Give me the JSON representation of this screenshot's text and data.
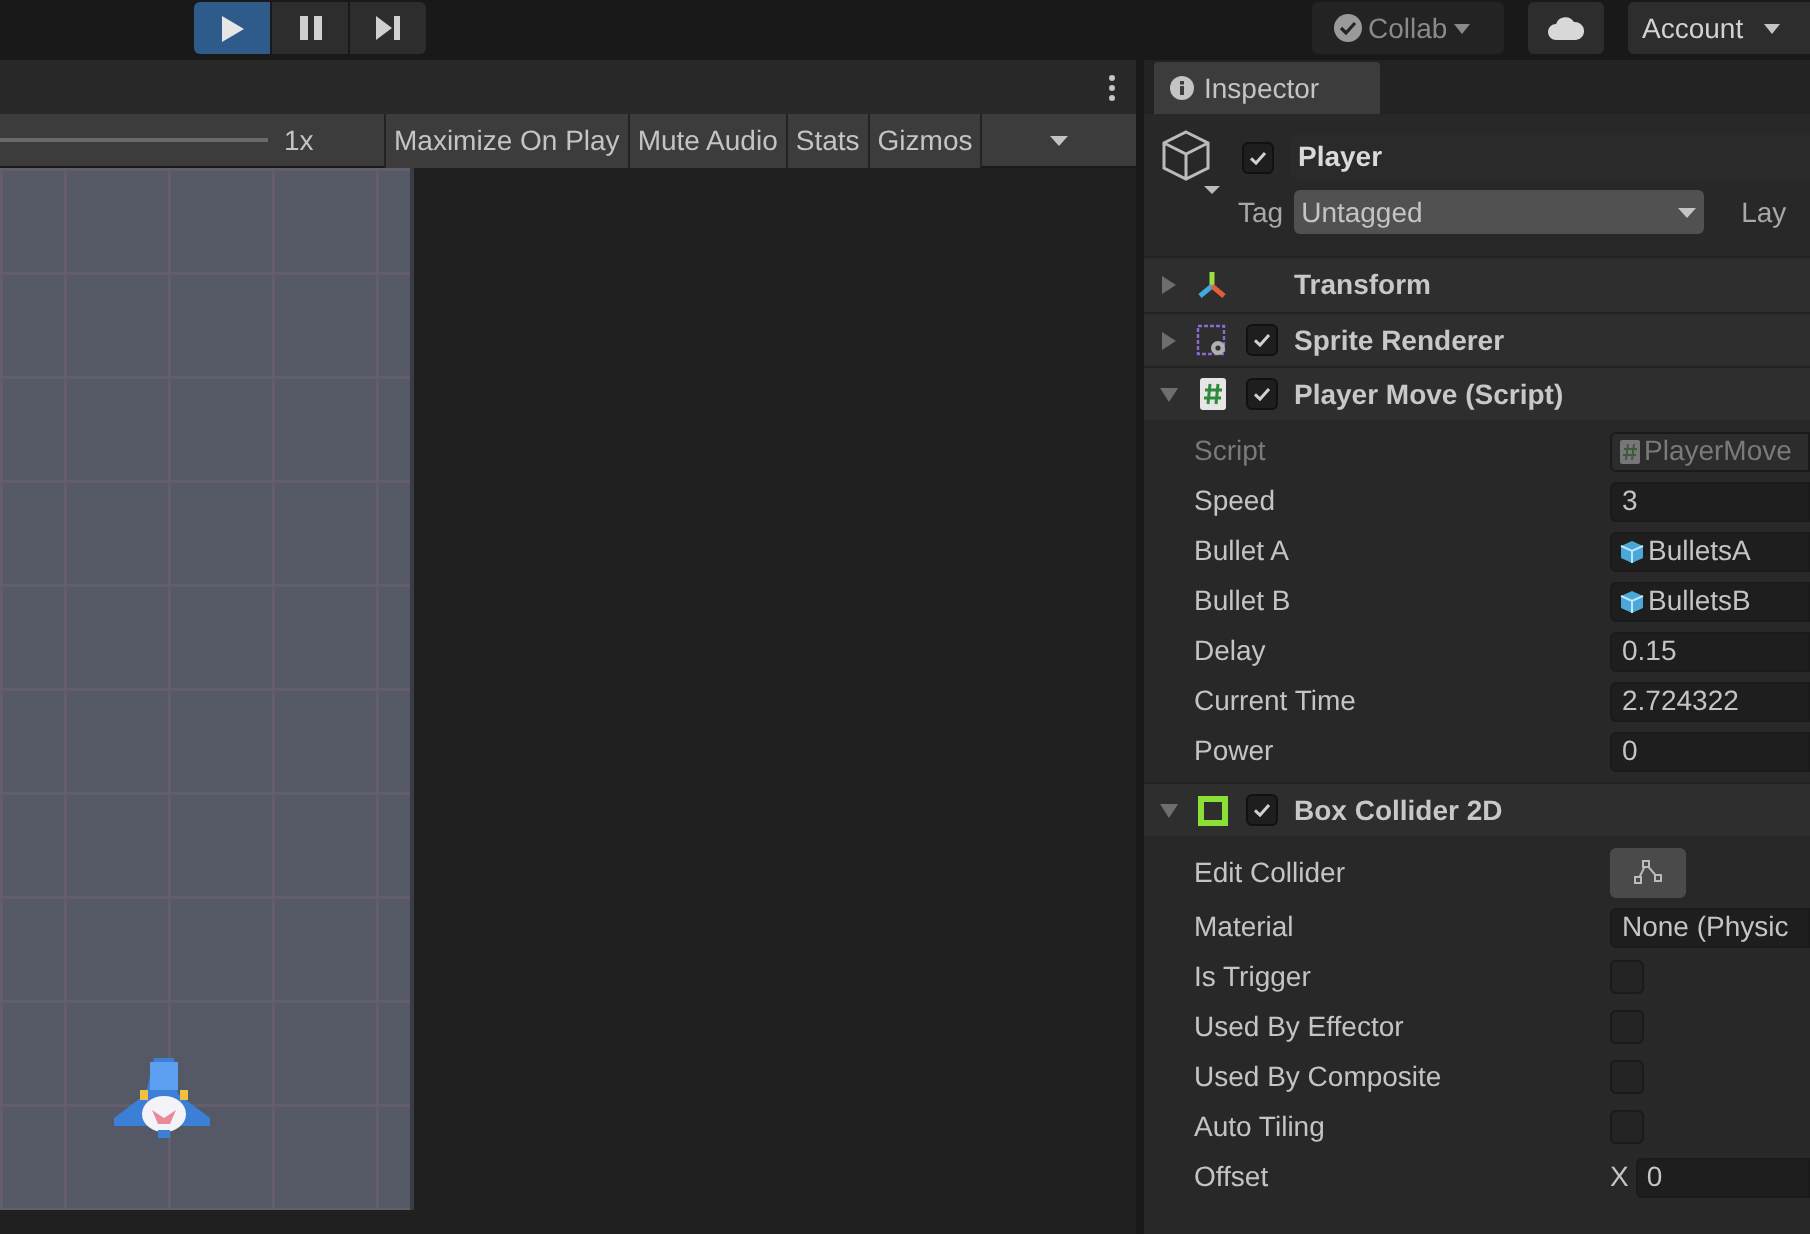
{
  "toolbar": {
    "play_buttons": [
      {
        "kind": "play",
        "selected": true
      },
      {
        "kind": "pause",
        "selected": false
      },
      {
        "kind": "step",
        "selected": false
      }
    ],
    "collab": "Collab",
    "account": "Account"
  },
  "game_view": {
    "scale": "1x",
    "buttons": [
      "Maximize On Play",
      "Mute Audio",
      "Stats",
      "Gizmos"
    ]
  },
  "inspector": {
    "tab": "Inspector",
    "object": {
      "active": true,
      "name": "Player",
      "tag_label": "Tag",
      "tag": "Untagged",
      "layer_label": "Lay"
    },
    "components": [
      {
        "kind": "transform",
        "name": "Transform",
        "expanded": false
      },
      {
        "kind": "sprite",
        "name": "Sprite Renderer",
        "expanded": false,
        "enabled": true
      },
      {
        "kind": "script",
        "name": "Player Move (Script)",
        "expanded": true,
        "enabled": true,
        "fields": [
          {
            "kind": "script",
            "label": "Script",
            "value": "PlayerMove",
            "disabled": true
          },
          {
            "kind": "text",
            "label": "Speed",
            "value": "3"
          },
          {
            "kind": "prefab",
            "label": "Bullet A",
            "value": "BulletsA"
          },
          {
            "kind": "prefab",
            "label": "Bullet B",
            "value": "BulletsB"
          },
          {
            "kind": "text",
            "label": "Delay",
            "value": "0.15"
          },
          {
            "kind": "text",
            "label": "Current Time",
            "value": "2.724322"
          },
          {
            "kind": "text",
            "label": "Power",
            "value": "0"
          }
        ]
      },
      {
        "kind": "collider",
        "name": "Box Collider 2D",
        "expanded": true,
        "enabled": true,
        "fields": [
          {
            "kind": "edit",
            "label": "Edit Collider"
          },
          {
            "kind": "text",
            "label": "Material",
            "value": "None (Physic"
          },
          {
            "kind": "check",
            "label": "Is Trigger",
            "checked": false
          },
          {
            "kind": "check",
            "label": "Used By Effector",
            "checked": false
          },
          {
            "kind": "check",
            "label": "Used By Composite",
            "checked": false
          },
          {
            "kind": "check",
            "label": "Auto Tiling",
            "checked": false
          },
          {
            "kind": "vector",
            "label": "Offset",
            "axis": "X",
            "value": "0"
          }
        ]
      }
    ]
  }
}
